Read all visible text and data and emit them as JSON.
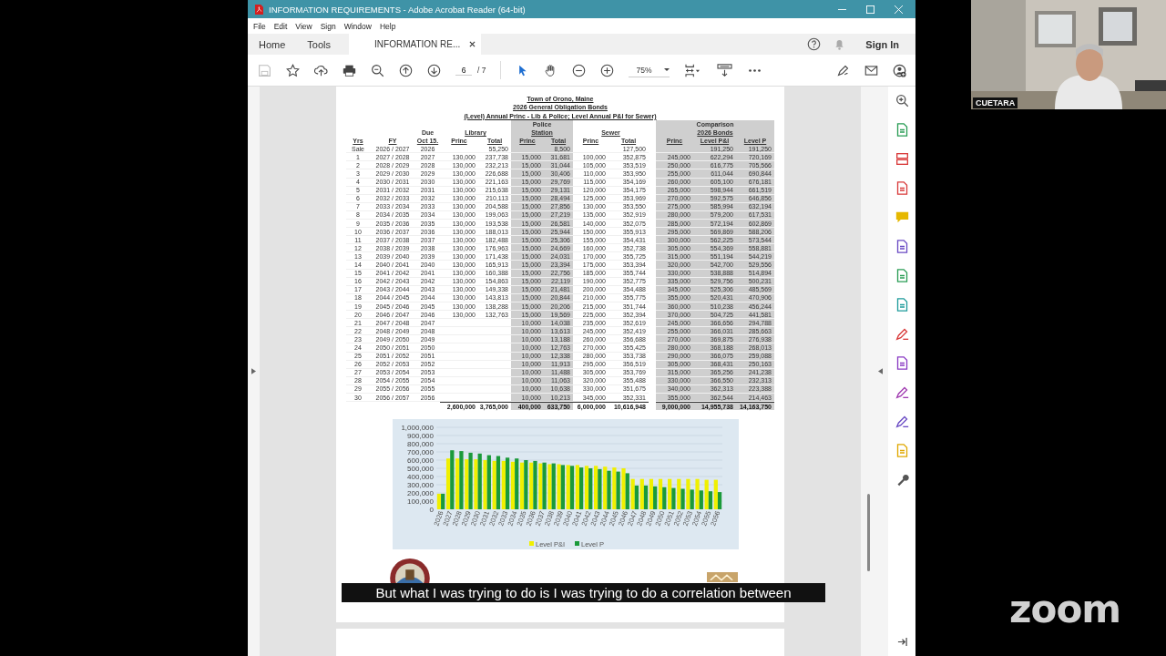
{
  "window": {
    "title": "INFORMATION REQUIREMENTS - Adobe Acrobat Reader (64-bit)"
  },
  "menu": [
    "File",
    "Edit",
    "View",
    "Sign",
    "Window",
    "Help"
  ],
  "tabs": [
    {
      "label": "Home",
      "selected": false
    },
    {
      "label": "Tools",
      "selected": false
    },
    {
      "label": "INFORMATION RE...",
      "selected": true
    }
  ],
  "sign_in": "Sign In",
  "toolbar": {
    "page": "6",
    "page_count": "/ 7",
    "zoom": "75%"
  },
  "document": {
    "title_lines": [
      "Town of Orono, Maine",
      "2026 General Obligation Bonds",
      "(Level) Annual Princ - Lib & Police; Level Annual P&I for Sewer)"
    ],
    "columns": [
      {
        "label": "Yrs"
      },
      {
        "label": "FY"
      },
      {
        "label": "Oct 15.",
        "above": "Due"
      }
    ],
    "groups": [
      {
        "lines": [
          "Library"
        ],
        "shaded": false,
        "columns": [
          "Princ",
          "Total"
        ]
      },
      {
        "lines": [
          "Police",
          "Station"
        ],
        "shaded": true,
        "columns": [
          "Princ",
          "Total"
        ]
      },
      {
        "lines": [
          "Sewer"
        ],
        "shaded": false,
        "columns": [
          "Princ",
          "Total"
        ]
      },
      {
        "lines": [
          "Comparison",
          "2026 Bonds"
        ],
        "shaded": true,
        "columns": [
          "Princ",
          "Level P&I",
          "Level P"
        ]
      }
    ],
    "rows": [
      [
        "Sale",
        "2026 / 2027",
        "2026",
        null,
        "55,250",
        null,
        "8,500",
        null,
        "127,500",
        null,
        "191,250",
        "191,250"
      ],
      [
        "1",
        "2027 / 2028",
        "2027",
        "130,000",
        "237,738",
        "15,000",
        "31,681",
        "100,000",
        "352,875",
        "245,000",
        "622,294",
        "720,169"
      ],
      [
        "2",
        "2028 / 2029",
        "2028",
        "130,000",
        "232,213",
        "15,000",
        "31,044",
        "105,000",
        "353,519",
        "250,000",
        "616,775",
        "705,566"
      ],
      [
        "3",
        "2029 / 2030",
        "2029",
        "130,000",
        "226,688",
        "15,000",
        "30,406",
        "110,000",
        "353,950",
        "255,000",
        "611,044",
        "690,844"
      ],
      [
        "4",
        "2030 / 2031",
        "2030",
        "130,000",
        "221,163",
        "15,000",
        "29,769",
        "115,000",
        "354,169",
        "260,000",
        "605,100",
        "676,181"
      ],
      [
        "5",
        "2031 / 2032",
        "2031",
        "130,000",
        "215,638",
        "15,000",
        "29,131",
        "120,000",
        "354,175",
        "265,000",
        "598,944",
        "661,519"
      ],
      [
        "6",
        "2032 / 2033",
        "2032",
        "130,000",
        "210,113",
        "15,000",
        "28,494",
        "125,000",
        "353,969",
        "270,000",
        "592,575",
        "646,856"
      ],
      [
        "7",
        "2033 / 2034",
        "2033",
        "130,000",
        "204,588",
        "15,000",
        "27,856",
        "130,000",
        "353,550",
        "275,000",
        "585,994",
        "632,194"
      ],
      [
        "8",
        "2034 / 2035",
        "2034",
        "130,000",
        "199,063",
        "15,000",
        "27,219",
        "135,000",
        "352,919",
        "280,000",
        "579,200",
        "617,531"
      ],
      [
        "9",
        "2035 / 2036",
        "2035",
        "130,000",
        "193,538",
        "15,000",
        "26,581",
        "140,000",
        "352,075",
        "285,000",
        "572,194",
        "602,869"
      ],
      [
        "10",
        "2036 / 2037",
        "2036",
        "130,000",
        "188,013",
        "15,000",
        "25,944",
        "150,000",
        "355,913",
        "295,000",
        "569,869",
        "588,206"
      ],
      [
        "11",
        "2037 / 2038",
        "2037",
        "130,000",
        "182,488",
        "15,000",
        "25,306",
        "155,000",
        "354,431",
        "300,000",
        "562,225",
        "573,544"
      ],
      [
        "12",
        "2038 / 2039",
        "2038",
        "130,000",
        "176,963",
        "15,000",
        "24,669",
        "160,000",
        "352,738",
        "305,000",
        "554,369",
        "558,881"
      ],
      [
        "13",
        "2039 / 2040",
        "2039",
        "130,000",
        "171,438",
        "15,000",
        "24,031",
        "170,000",
        "355,725",
        "315,000",
        "551,194",
        "544,219"
      ],
      [
        "14",
        "2040 / 2041",
        "2040",
        "130,000",
        "165,913",
        "15,000",
        "23,394",
        "175,000",
        "353,394",
        "320,000",
        "542,700",
        "529,556"
      ],
      [
        "15",
        "2041 / 2042",
        "2041",
        "130,000",
        "160,388",
        "15,000",
        "22,756",
        "185,000",
        "355,744",
        "330,000",
        "538,888",
        "514,894"
      ],
      [
        "16",
        "2042 / 2043",
        "2042",
        "130,000",
        "154,863",
        "15,000",
        "22,119",
        "190,000",
        "352,775",
        "335,000",
        "529,756",
        "500,231"
      ],
      [
        "17",
        "2043 / 2044",
        "2043",
        "130,000",
        "149,338",
        "15,000",
        "21,481",
        "200,000",
        "354,488",
        "345,000",
        "525,306",
        "485,569"
      ],
      [
        "18",
        "2044 / 2045",
        "2044",
        "130,000",
        "143,813",
        "15,000",
        "20,844",
        "210,000",
        "355,775",
        "355,000",
        "520,431",
        "470,906"
      ],
      [
        "19",
        "2045 / 2046",
        "2045",
        "130,000",
        "138,288",
        "15,000",
        "20,206",
        "215,000",
        "351,744",
        "360,000",
        "510,238",
        "456,244"
      ],
      [
        "20",
        "2046 / 2047",
        "2046",
        "130,000",
        "132,763",
        "15,000",
        "19,569",
        "225,000",
        "352,394",
        "370,000",
        "504,725",
        "441,581"
      ],
      [
        "21",
        "2047 / 2048",
        "2047",
        null,
        null,
        "10,000",
        "14,038",
        "235,000",
        "352,619",
        "245,000",
        "366,656",
        "294,788"
      ],
      [
        "22",
        "2048 / 2049",
        "2048",
        null,
        null,
        "10,000",
        "13,613",
        "245,000",
        "352,419",
        "255,000",
        "366,031",
        "285,663"
      ],
      [
        "23",
        "2049 / 2050",
        "2049",
        null,
        null,
        "10,000",
        "13,188",
        "260,000",
        "356,688",
        "270,000",
        "369,875",
        "276,938"
      ],
      [
        "24",
        "2050 / 2051",
        "2050",
        null,
        null,
        "10,000",
        "12,763",
        "270,000",
        "355,425",
        "280,000",
        "368,188",
        "268,013"
      ],
      [
        "25",
        "2051 / 2052",
        "2051",
        null,
        null,
        "10,000",
        "12,338",
        "280,000",
        "353,738",
        "290,000",
        "366,075",
        "259,088"
      ],
      [
        "26",
        "2052 / 2053",
        "2052",
        null,
        null,
        "10,000",
        "11,913",
        "295,000",
        "356,519",
        "305,000",
        "368,431",
        "250,163"
      ],
      [
        "27",
        "2053 / 2054",
        "2053",
        null,
        null,
        "10,000",
        "11,488",
        "305,000",
        "353,769",
        "315,000",
        "365,256",
        "241,238"
      ],
      [
        "28",
        "2054 / 2055",
        "2054",
        null,
        null,
        "10,000",
        "11,063",
        "320,000",
        "355,488",
        "330,000",
        "366,550",
        "232,313"
      ],
      [
        "29",
        "2055 / 2056",
        "2055",
        null,
        null,
        "10,000",
        "10,638",
        "330,000",
        "351,675",
        "340,000",
        "362,313",
        "223,388"
      ],
      [
        "30",
        "2056 / 2057",
        "2056",
        null,
        null,
        "10,000",
        "10,213",
        "345,000",
        "352,331",
        "355,000",
        "362,544",
        "214,463"
      ]
    ],
    "totals": [
      "2,600,000",
      "3,765,000",
      "400,000",
      "633,750",
      "6,000,000",
      "10,616,948",
      "9,000,000",
      "14,955,738",
      "14,163,750"
    ],
    "chart": {
      "chart_data": {
        "type": "bar",
        "yticks": [
          {
            "value": 0,
            "label": "0"
          },
          {
            "value": 100000,
            "label": "100,000"
          },
          {
            "value": 200000,
            "label": "200,000"
          },
          {
            "value": 300000,
            "label": "300,000"
          },
          {
            "value": 400000,
            "label": "400,000"
          },
          {
            "value": 500000,
            "label": "500,000"
          },
          {
            "value": 600000,
            "label": "600,000"
          },
          {
            "value": 700000,
            "label": "700,000"
          },
          {
            "value": 800000,
            "label": "800,000"
          },
          {
            "value": 900000,
            "label": "900,000"
          },
          {
            "value": 1000000,
            "label": "1,000,000"
          }
        ],
        "ylim": [
          0,
          1000000
        ],
        "grid": true,
        "legend": true,
        "categories": [
          "2026",
          "2027",
          "2028",
          "2029",
          "2030",
          "2031",
          "2032",
          "2033",
          "2034",
          "2035",
          "2036",
          "2037",
          "2038",
          "2039",
          "2040",
          "2041",
          "2042",
          "2043",
          "2044",
          "2045",
          "2046",
          "2047",
          "2048",
          "2049",
          "2050",
          "2051",
          "2052",
          "2053",
          "2054",
          "2055",
          "2056"
        ],
        "series": [
          {
            "name": "Level P&I",
            "color": "#f0f000",
            "values": [
              190000,
              620000,
              620000,
              610000,
              610000,
              600000,
              590000,
              590000,
              580000,
              570000,
              570000,
              560000,
              550000,
              550000,
              540000,
              540000,
              530000,
              530000,
              520000,
              510000,
              500000,
              370000,
              370000,
              370000,
              370000,
              370000,
              370000,
              370000,
              370000,
              360000,
              360000
            ]
          },
          {
            "name": "Level P",
            "color": "#1a9a3a",
            "values": [
              190000,
              720000,
              710000,
              690000,
              680000,
              660000,
              650000,
              630000,
              620000,
              600000,
              590000,
              570000,
              560000,
              540000,
              530000,
              510000,
              500000,
              490000,
              470000,
              460000,
              440000,
              290000,
              290000,
              280000,
              270000,
              260000,
              250000,
              240000,
              230000,
              220000,
              210000
            ]
          }
        ]
      }
    }
  },
  "caption": "But what I was trying to do is I was trying to do a correlation between",
  "participant": {
    "name": "CUETARA"
  },
  "brand": "zoom"
}
